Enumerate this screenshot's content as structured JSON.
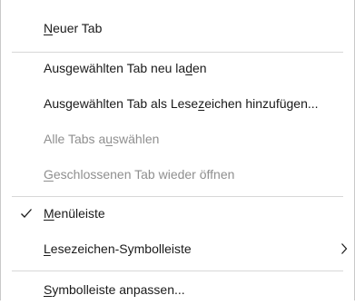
{
  "menu": {
    "items": [
      {
        "pre": "",
        "acc": "N",
        "post": "euer Tab"
      },
      {
        "pre": "Ausgewählten Tab neu la",
        "acc": "d",
        "post": "en"
      },
      {
        "pre": "Ausgewählten Tab als Lese",
        "acc": "z",
        "post": "eichen hinzufügen..."
      },
      {
        "pre": "Alle Tabs a",
        "acc": "u",
        "post": "swählen"
      },
      {
        "pre": "",
        "acc": "G",
        "post": "eschlossenen Tab wieder öffnen"
      },
      {
        "pre": "",
        "acc": "M",
        "post": "enüleiste"
      },
      {
        "pre": "",
        "acc": "L",
        "post": "esezeichen-Symbolleiste"
      },
      {
        "pre": "",
        "acc": "S",
        "post": "ymbolleiste anpassen..."
      }
    ],
    "check_icon": "checkmark-icon",
    "submenu_icon": "chevron-right-icon",
    "colors": {
      "text": "#1a1a1a",
      "disabled_text": "#8f8f8f",
      "separator": "#d7d7d7",
      "background": "#ffffff"
    }
  }
}
